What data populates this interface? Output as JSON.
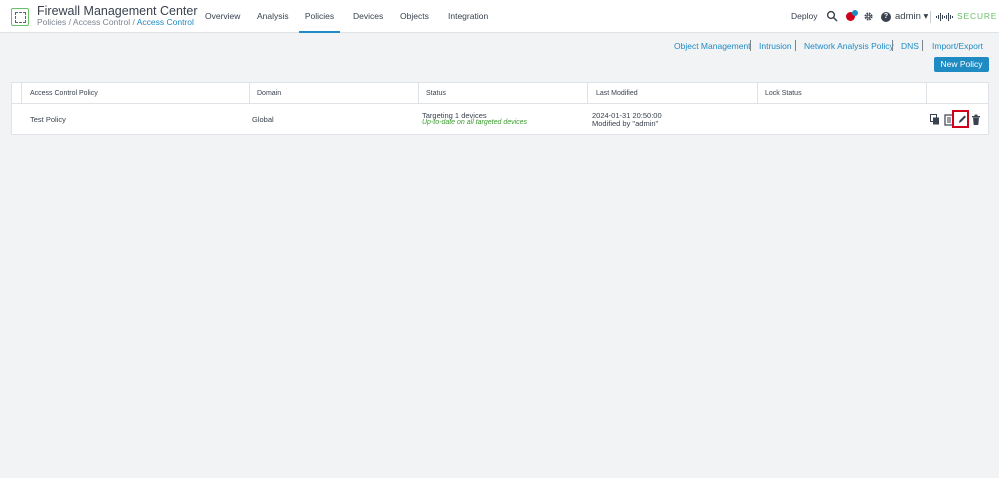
{
  "header": {
    "app_title": "Firewall Management Center",
    "breadcrumb": {
      "part1": "Policies",
      "sep1": " / ",
      "part2": "Access Control",
      "sep2": " / ",
      "current": "Access Control"
    },
    "nav": [
      {
        "label": "Overview"
      },
      {
        "label": "Analysis"
      },
      {
        "label": "Policies"
      },
      {
        "label": "Devices"
      },
      {
        "label": "Objects"
      },
      {
        "label": "Integration"
      }
    ],
    "active_nav": "Policies",
    "deploy_label": "Deploy",
    "user_label": "admin ▾",
    "brand_label": "SECURE",
    "icons": [
      "search-icon",
      "alert-icon",
      "gear-icon",
      "help-icon",
      "cisco-logo-icon"
    ]
  },
  "sublinks": [
    {
      "label": "Object Management"
    },
    {
      "label": "Intrusion"
    },
    {
      "label": "Network Analysis Policy"
    },
    {
      "label": "DNS"
    },
    {
      "label": "Import/Export"
    }
  ],
  "new_policy_label": "New Policy",
  "table": {
    "columns": [
      "Access Control Policy",
      "Domain",
      "Status",
      "Last Modified",
      "Lock Status"
    ],
    "rows": [
      {
        "name": "Test Policy",
        "domain": "Global",
        "status": "Targeting 1 devices",
        "status_sub": "Up-to-date on all targeted devices",
        "modified_date": "2024-01-31 20:50:00",
        "modified_by": "Modified by \"admin\"",
        "lock_status": "",
        "actions": [
          "copy-icon",
          "report-icon",
          "edit-icon",
          "delete-icon"
        ]
      }
    ]
  },
  "colors": {
    "accent": "#1e8bc3",
    "success_text": "#3c9d2f",
    "highlight_box": "#d0021b",
    "brand_green": "#6abf69"
  }
}
